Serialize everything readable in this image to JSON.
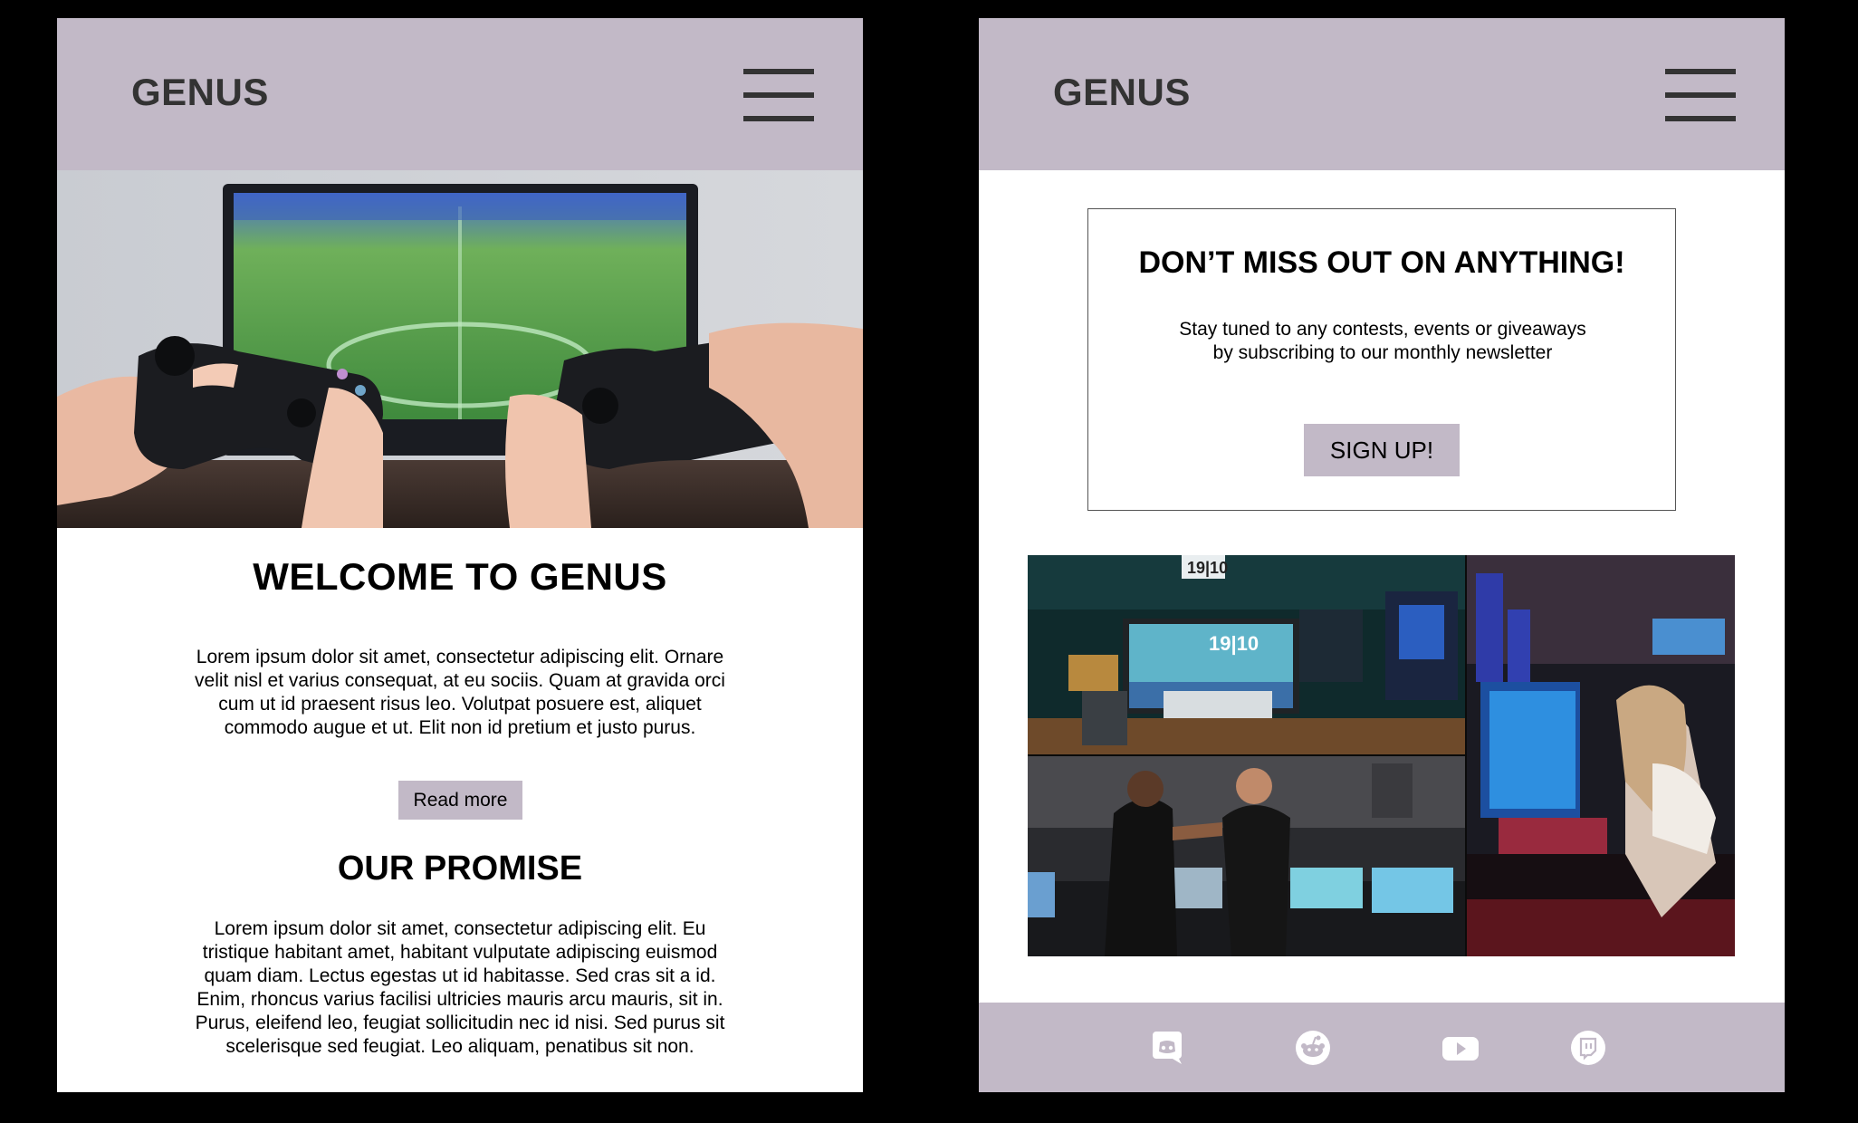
{
  "brand": {
    "logo": "GENUS"
  },
  "home": {
    "welcome_title": "WELCOME TO GENUS",
    "welcome_body": "Lorem ipsum dolor sit amet, consectetur adipiscing elit. Ornare velit nisl et varius consequat, at eu sociis. Quam at gravida orci cum ut id praesent risus leo. Volutpat posuere est, aliquet commodo augue et ut. Elit non id pretium et justo purus.",
    "read_more_label": "Read more",
    "promise_title": "OUR PROMISE",
    "promise_body": "Lorem ipsum dolor sit amet, consectetur adipiscing elit. Eu tristique habitant amet, habitant vulputate adipiscing euismod quam diam. Lectus egestas ut id habitasse. Sed cras sit a id. Enim, rhoncus varius facilisi ultricies mauris arcu mauris, sit in. Purus, eleifend leo, feugiat sollicitudin nec id nisi. Sed purus sit scelerisque sed feugiat. Leo aliquam, penatibus sit non."
  },
  "newsletter": {
    "title": "DON’T MISS OUT ON ANYTHING!",
    "body": "Stay tuned to any contests, events or giveaways by subscribing to our monthly newsletter",
    "signup_label": "SIGN UP!"
  },
  "gallery": {
    "clock_text": "19|10"
  },
  "footer": {
    "socials": [
      "discord-icon",
      "reddit-icon",
      "youtube-icon",
      "twitch-icon"
    ]
  },
  "colors": {
    "accent": "#c2b9c7",
    "text_dark": "#333333",
    "background": "#000000"
  }
}
